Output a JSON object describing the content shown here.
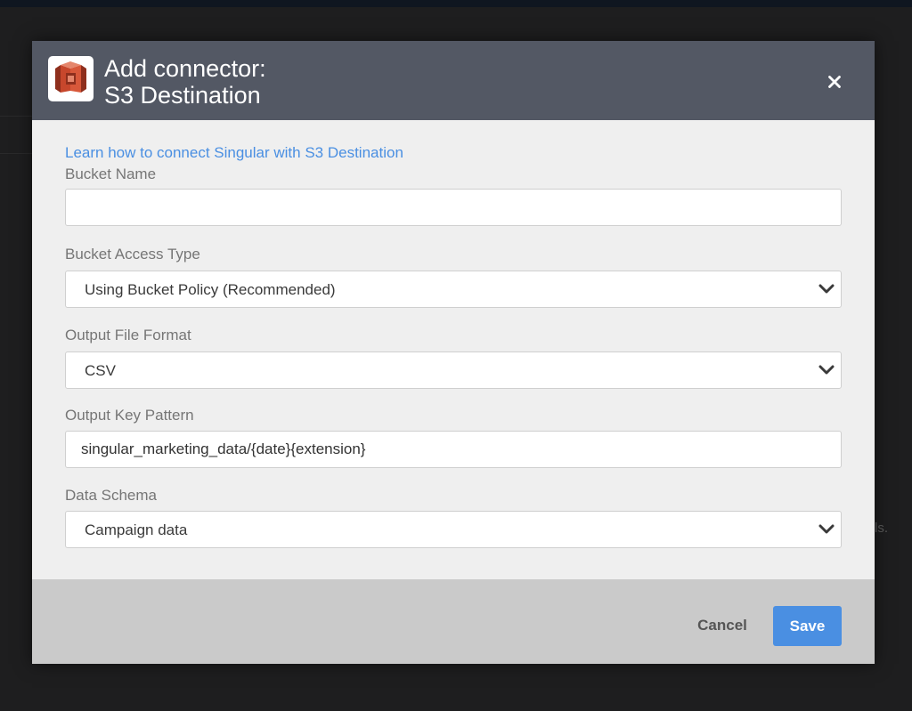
{
  "background": {
    "fragment_text": "ls."
  },
  "modal": {
    "logo_icon": "aws-s3-icon",
    "title_line1": "Add connector:",
    "title_line2": "S3 Destination",
    "close_icon": "close-icon",
    "help_link": "Learn how to connect Singular with S3 Destination",
    "fields": {
      "bucket_name": {
        "label": "Bucket Name",
        "value": "",
        "placeholder": ""
      },
      "bucket_access_type": {
        "label": "Bucket Access Type",
        "selected": "Using Bucket Policy (Recommended)"
      },
      "output_file_format": {
        "label": "Output File Format",
        "selected": "CSV"
      },
      "output_key_pattern": {
        "label": "Output Key Pattern",
        "value": "singular_marketing_data/{date}{extension}"
      },
      "data_schema": {
        "label": "Data Schema",
        "selected": "Campaign data"
      }
    },
    "footer": {
      "cancel_label": "Cancel",
      "save_label": "Save"
    }
  },
  "colors": {
    "header_bg": "#535864",
    "accent": "#4a8fe2",
    "body_bg": "#efefef",
    "footer_bg": "#cacaca",
    "logo_primary": "#c7472c"
  }
}
